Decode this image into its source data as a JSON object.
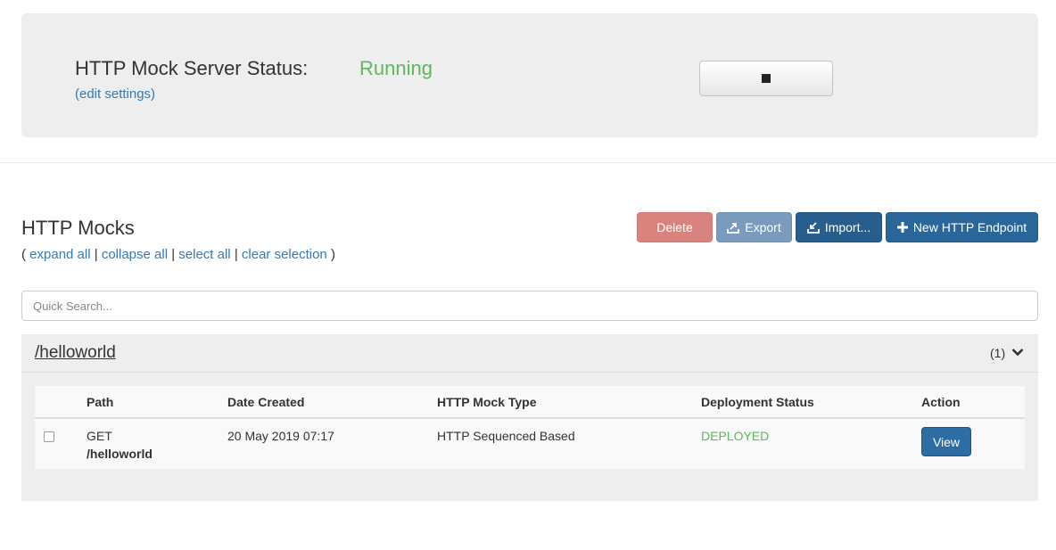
{
  "server": {
    "status_label": "HTTP Mock Server Status:",
    "status_value": "Running",
    "status_color": "#5cb85c",
    "edit_settings_link": "(edit settings)",
    "stop_button_icon": "stop-icon"
  },
  "mocks": {
    "title": "HTTP Mocks",
    "links": {
      "open_paren": "(",
      "expand_all": "expand all",
      "sep1": "|",
      "collapse_all": "collapse all",
      "sep2": "|",
      "select_all": "select all",
      "sep3": "|",
      "clear_selection": "clear selection",
      "close_paren": ")"
    },
    "buttons": {
      "delete": "Delete",
      "export": "Export",
      "import": "Import...",
      "new_endpoint": "New HTTP Endpoint"
    },
    "search": {
      "placeholder": "Quick Search...",
      "value": ""
    }
  },
  "group": {
    "title": "/helloworld",
    "count": "(1)",
    "columns": {
      "path": "Path",
      "date_created": "Date Created",
      "mock_type": "HTTP Mock Type",
      "deployment_status": "Deployment Status",
      "action": "Action"
    },
    "rows": [
      {
        "method": "GET",
        "path": "/helloworld",
        "date_created": "20 May 2019 07:17",
        "mock_type": "HTTP Sequenced Based",
        "deployment_status": "DEPLOYED",
        "action_label": "View"
      }
    ]
  },
  "colors": {
    "delete_button": "#d9837f",
    "export_button": "#7a9bbd",
    "primary_button": "#2b669a",
    "link": "#337ab7",
    "deployed": "#5cb85c"
  }
}
